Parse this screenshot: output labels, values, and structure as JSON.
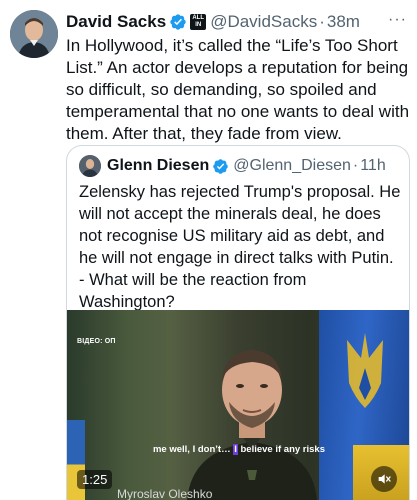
{
  "tweet": {
    "author_name": "David Sacks",
    "author_handle": "@DavidSacks",
    "separator": "·",
    "time": "38m",
    "org_badge_line1": "ALL",
    "org_badge_line2": "IN",
    "more_label": "···",
    "text": "In Hollywood, it’s called the “Life’s Too Short List.” An actor develops a reputation for being so difficult, so demanding, so spoiled and temperamental that no one wants to deal with them. After that, they fade from view."
  },
  "quote": {
    "author_name": "Glenn Diesen",
    "author_handle": "@Glenn_Diesen",
    "separator": "·",
    "time": "11h",
    "text": "Zelensky has rejected Trump's proposal. He will not accept the minerals deal, he does not recognise US military aid as debt, and he will not engage in direct talks with Putin. - What will be the reaction from Washington?"
  },
  "video": {
    "source_tag": "ВІДЕО: ОП",
    "caption_before": "me well, I don’t… ",
    "caption_highlight": "I",
    "caption_after": " believe if any risks",
    "duration": "1:25",
    "name_strip": "Myroslav Oleshko"
  },
  "colors": {
    "verified_blue": "#1d9bf0",
    "secondary_text": "#536471",
    "primary_text": "#0f1419",
    "caption_highlight": "#6e3fd8"
  },
  "icons": {
    "verified": "verified-check-icon",
    "more": "more-dots-icon",
    "mute": "speaker-muted-icon"
  }
}
